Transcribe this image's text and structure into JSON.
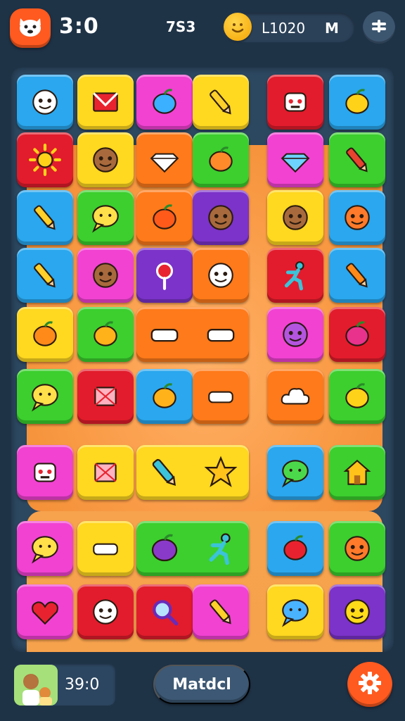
{
  "header": {
    "timer": "3:0",
    "score": "7S3",
    "coins": "L1020",
    "coins_suffix": "M",
    "home_icon": "fox-face-icon",
    "coin_icon": "smiley-coin-icon",
    "menu_icon": "menu-icon"
  },
  "footer": {
    "player_score": "39:0",
    "match_label": "Matdcl",
    "avatar_icon": "player-avatar-icon",
    "settings_icon": "gear-icon"
  },
  "colors": {
    "background": "#1f3347",
    "accent": "#ff5a1f",
    "board_glow": "#f99a45"
  },
  "board": {
    "tiles": [
      {
        "row": 1,
        "col": 1,
        "color": "#2aa7ee",
        "icon": "eyes-face-icon"
      },
      {
        "row": 1,
        "col": 2,
        "color": "#ffd820",
        "icon": "envelope-icon"
      },
      {
        "row": 1,
        "col": 3,
        "color": "#f142d2",
        "icon": "water-drop-icon"
      },
      {
        "row": 1,
        "col": 4,
        "color": "#ffd820",
        "icon": "magic-wand-icon"
      },
      {
        "row": 1,
        "col": 5,
        "color": "#e21c2c",
        "icon": "robot-face-icon"
      },
      {
        "row": 1,
        "col": 6,
        "color": "#2aa7ee",
        "icon": "banana-icon"
      },
      {
        "row": 2,
        "col": 1,
        "color": "#e21c2c",
        "icon": "sun-icon"
      },
      {
        "row": 2,
        "col": 2,
        "color": "#ffd820",
        "icon": "face-icon"
      },
      {
        "row": 2,
        "col": 3,
        "color": "#ff7a1a",
        "icon": "diamond-icon"
      },
      {
        "row": 2,
        "col": 4,
        "color": "#3ccf2e",
        "icon": "leaf-icon"
      },
      {
        "row": 2,
        "col": 5,
        "color": "#f142d2",
        "icon": "gem-icon"
      },
      {
        "row": 2,
        "col": 6,
        "color": "#3ccf2e",
        "icon": "feather-icon"
      },
      {
        "row": 3,
        "col": 1,
        "color": "#2aa7ee",
        "icon": "pencil-icon"
      },
      {
        "row": 3,
        "col": 2,
        "color": "#3ccf2e",
        "icon": "smile-bubble-icon"
      },
      {
        "row": 3,
        "col": 3,
        "color": "#ff7a1a",
        "icon": "bird-icon"
      },
      {
        "row": 3,
        "col": 4,
        "color": "#7b33c9",
        "icon": "face-icon"
      },
      {
        "row": 3,
        "col": 5,
        "color": "#ffd820",
        "icon": "potato-face-icon"
      },
      {
        "row": 3,
        "col": 6,
        "color": "#2aa7ee",
        "icon": "cat-face-icon"
      },
      {
        "row": 4,
        "col": 1,
        "color": "#2aa7ee",
        "icon": "crayon-icon"
      },
      {
        "row": 4,
        "col": 2,
        "color": "#f142d2",
        "icon": "face-icon"
      },
      {
        "row": 4,
        "col": 3,
        "color": "#7b33c9",
        "icon": "lollipop-icon"
      },
      {
        "row": 4,
        "col": 4,
        "color": "#ff7a1a",
        "icon": "ghost-sack-icon"
      },
      {
        "row": 4,
        "col": 5,
        "color": "#e21c2c",
        "icon": "runner-icon"
      },
      {
        "row": 4,
        "col": 6,
        "color": "#2aa7ee",
        "icon": "carrot-icon"
      },
      {
        "row": 5,
        "col": 1,
        "color": "#ffd820",
        "icon": "pepper-icon"
      },
      {
        "row": 5,
        "col": 2,
        "color": "#3ccf2e",
        "icon": "melon-icon"
      },
      {
        "row": 5,
        "col": 5,
        "color": "#f142d2",
        "icon": "blob-face-icon"
      },
      {
        "row": 5,
        "col": 6,
        "color": "#e21c2c",
        "icon": "radish-icon"
      },
      {
        "row": 6,
        "col": 1,
        "color": "#3ccf2e",
        "icon": "speech-bubble-icon"
      },
      {
        "row": 6,
        "col": 2,
        "color": "#e21c2c",
        "icon": "picture-frame-icon"
      },
      {
        "row": 6,
        "col": 3,
        "color": "#2aa7ee",
        "icon": "orange-icon"
      },
      {
        "row": 6,
        "col": 4,
        "color": "#ff7a1a",
        "icon": "candy-icon"
      },
      {
        "row": 6,
        "col": 5,
        "color": "#ff7a1a",
        "icon": "cloud-icon"
      },
      {
        "row": 6,
        "col": 6,
        "color": "#3ccf2e",
        "icon": "fruit-icon"
      },
      {
        "row": 7,
        "col": 1,
        "color": "#f142d2",
        "icon": "robot-icon"
      },
      {
        "row": 7,
        "col": 2,
        "color": "#ffd820",
        "icon": "box-icon"
      },
      {
        "row": 7,
        "col": 5,
        "color": "#2aa7ee",
        "icon": "frog-bubble-icon"
      },
      {
        "row": 7,
        "col": 6,
        "color": "#3ccf2e",
        "icon": "house-icon"
      },
      {
        "row": 8,
        "col": 1,
        "color": "#f142d2",
        "icon": "speech-bubble-icon"
      },
      {
        "row": 8,
        "col": 2,
        "color": "#ffd820",
        "icon": "bottle-icon"
      },
      {
        "row": 8,
        "col": 5,
        "color": "#2aa7ee",
        "icon": "tomato-icon"
      },
      {
        "row": 8,
        "col": 6,
        "color": "#3ccf2e",
        "icon": "pumpkin-face-icon"
      },
      {
        "row": 9,
        "col": 1,
        "color": "#f142d2",
        "icon": "heart-icon"
      },
      {
        "row": 9,
        "col": 2,
        "color": "#e21c2c",
        "icon": "ghost-icon"
      },
      {
        "row": 9,
        "col": 3,
        "color": "#e21c2c",
        "icon": "magnifier-icon"
      },
      {
        "row": 9,
        "col": 4,
        "color": "#f142d2",
        "icon": "pencil-icon"
      },
      {
        "row": 9,
        "col": 5,
        "color": "#ffd820",
        "icon": "bird-bubble-icon"
      },
      {
        "row": 9,
        "col": 6,
        "color": "#7b33c9",
        "icon": "lemon-face-icon"
      }
    ],
    "wide_tiles": [
      {
        "row": 5,
        "col": 3,
        "span": 2,
        "color": "#ff7a1a",
        "icons": [
          "arrow-icon",
          "wrench-icon"
        ]
      },
      {
        "row": 7,
        "col": 3,
        "span": 2,
        "color": "#ffd820",
        "icons": [
          "sword-icon",
          "star-icon"
        ]
      },
      {
        "row": 8,
        "col": 3,
        "span": 2,
        "color": "#3ccf2e",
        "icons": [
          "eggplant-icon",
          "runner-icon"
        ]
      }
    ]
  }
}
